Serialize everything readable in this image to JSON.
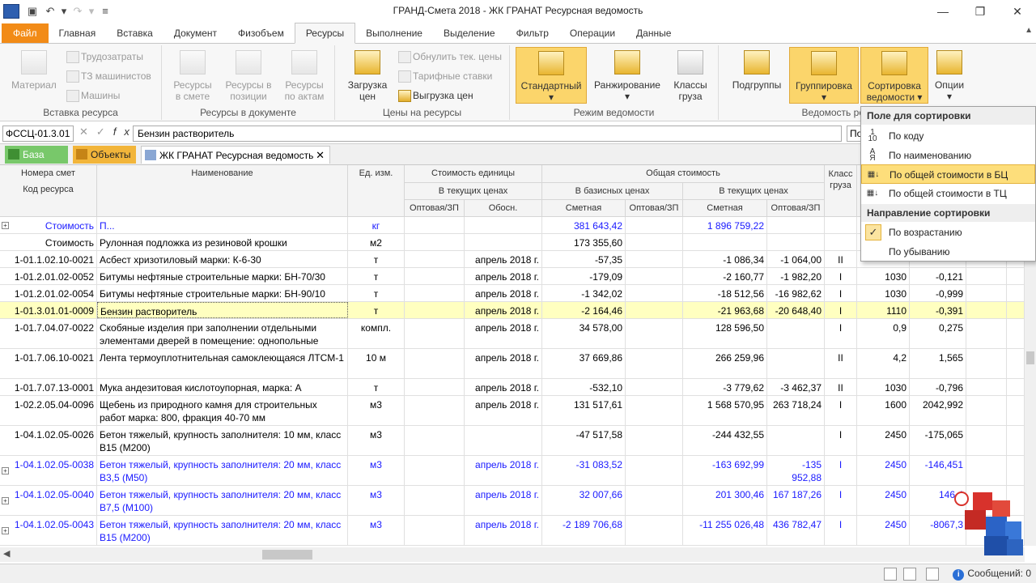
{
  "window": {
    "title": "ГРАНД-Смета 2018 - ЖК ГРАНАТ Ресурсная ведомость"
  },
  "menu_tabs": [
    "Файл",
    "Главная",
    "Вставка",
    "Документ",
    "Физобъем",
    "Ресурсы",
    "Выполнение",
    "Выделение",
    "Фильтр",
    "Операции",
    "Данные"
  ],
  "ribbon": {
    "insert_group": {
      "label": "Вставка ресурса",
      "material": "Материал",
      "labor": "Трудозатраты",
      "machinists": "ТЗ машинистов",
      "machines": "Машины"
    },
    "doc_group": {
      "label": "Ресурсы в документе",
      "in_estimate_1": "Ресурсы",
      "in_estimate_2": "в смете",
      "in_position_1": "Ресурсы в",
      "in_position_2": "позиции",
      "by_acts_1": "Ресурсы",
      "by_acts_2": "по актам"
    },
    "prices_group": {
      "label": "Цены на ресурсы",
      "load_1": "Загрузка",
      "load_2": "цен",
      "reset": "Обнулить тек. цены",
      "tariff": "Тарифные ставки",
      "unload": "Выгрузка цен"
    },
    "mode_group": {
      "label": "Режим ведомости",
      "standard": "Стандартный",
      "ranking": "Ранжирование",
      "classes_1": "Классы",
      "classes_2": "груза"
    },
    "ved_group": {
      "label": "Ведомость ре",
      "subgroups": "Подгруппы",
      "grouping": "Группировка",
      "sort_1": "Сортировка",
      "sort_2": "ведомости",
      "options": "Опции"
    }
  },
  "formula": {
    "cell_ref": "ФССЦ-01.3.01",
    "value": "Бензин растворитель",
    "right_value": "По"
  },
  "doc_tabs": {
    "base": "База",
    "objects": "Объекты",
    "document": "ЖК ГРАНАТ Ресурсная ведомость"
  },
  "table": {
    "headers": {
      "num": "Номера смет",
      "code": "Код ресурса",
      "name": "Наименование",
      "unit": "Ед. изм.",
      "unit_cost": "Стоимость единицы",
      "current_prices": "В текущих ценах",
      "wholesale": "Оптовая/ЗП",
      "basis": "Обосн.",
      "total_cost": "Общая стоимость",
      "base_prices": "В базисных ценах",
      "current_prices2": "В текущих ценах",
      "estimate": "Сметная",
      "wholesale2": "Оптовая/ЗП",
      "estimate2": "Сметная",
      "wholesale3": "Оптовая/ЗП",
      "class_1": "Класс",
      "class_2": "груза"
    },
    "rows": [
      {
        "code": "Стоимость",
        "name": "П...",
        "unit": "кг",
        "wholesale": "",
        "basis": "",
        "base_est": "381 643,42",
        "base_wh": "",
        "cur_est": "1 896 759,22",
        "cur_wh": "",
        "cls": "",
        "mass": "",
        "diff": "",
        "style": "blue",
        "expander": "+"
      },
      {
        "code": "Стоимость",
        "name": "Рулонная подложка из резиновой крошки",
        "unit": "м2",
        "wholesale": "",
        "basis": "",
        "base_est": "173 355,60",
        "base_wh": "",
        "cur_est": "",
        "cur_wh": "",
        "cls": "",
        "mass": "",
        "diff": "",
        "style": "",
        "expander": ""
      },
      {
        "code": "1-01.1.02.10-0021",
        "name": "Асбест хризотиловый марки: К-6-30",
        "unit": "т",
        "wholesale": "",
        "basis": "апрель 2018 г.",
        "base_est": "-57,35",
        "base_wh": "",
        "cur_est": "-1 086,34",
        "cur_wh": "-1 064,00",
        "cls": "II",
        "mass": "",
        "diff": "",
        "style": "",
        "expander": ""
      },
      {
        "code": "1-01.2.01.02-0052",
        "name": "Битумы нефтяные строительные марки: БН-70/30",
        "unit": "т",
        "wholesale": "",
        "basis": "апрель 2018 г.",
        "base_est": "-179,09",
        "base_wh": "",
        "cur_est": "-2 160,77",
        "cur_wh": "-1 982,20",
        "cls": "I",
        "mass": "1030",
        "diff": "-0,121",
        "style": "",
        "expander": ""
      },
      {
        "code": "1-01.2.01.02-0054",
        "name": "Битумы нефтяные строительные марки: БН-90/10",
        "unit": "т",
        "wholesale": "",
        "basis": "апрель 2018 г.",
        "base_est": "-1 342,02",
        "base_wh": "",
        "cur_est": "-18 512,56",
        "cur_wh": "-16 982,62",
        "cls": "I",
        "mass": "1030",
        "diff": "-0,999",
        "style": "",
        "expander": ""
      },
      {
        "code": "1-01.3.01.01-0009",
        "name": "Бензин растворитель",
        "unit": "т",
        "wholesale": "",
        "basis": "апрель 2018 г.",
        "base_est": "-2 164,46",
        "base_wh": "",
        "cur_est": "-21 963,68",
        "cur_wh": "-20 648,40",
        "cls": "I",
        "mass": "1110",
        "diff": "-0,391",
        "style": "hl",
        "expander": ""
      },
      {
        "code": "1-01.7.04.07-0022",
        "name": "Скобяные изделия при заполнении отдельными элементами дверей в помещение: однопольные",
        "unit": "компл.",
        "wholesale": "",
        "basis": "апрель 2018 г.",
        "base_est": "34 578,00",
        "base_wh": "",
        "cur_est": "128 596,50",
        "cur_wh": "",
        "cls": "I",
        "mass": "0,9",
        "diff": "0,275",
        "style": "",
        "expander": ""
      },
      {
        "code": "1-01.7.06.10-0021",
        "name": "Лента термоуплотнительная самоклеющаяся ЛТСМ-1",
        "unit": "10 м",
        "wholesale": "",
        "basis": "апрель 2018 г.",
        "base_est": "37 669,86",
        "base_wh": "",
        "cur_est": "266 259,96",
        "cur_wh": "",
        "cls": "II",
        "mass": "4,2",
        "diff": "1,565",
        "style": "",
        "expander": ""
      },
      {
        "code": "1-01.7.07.13-0001",
        "name": "Мука андезитовая кислотоупорная, марка: А",
        "unit": "т",
        "wholesale": "",
        "basis": "апрель 2018 г.",
        "base_est": "-532,10",
        "base_wh": "",
        "cur_est": "-3 779,62",
        "cur_wh": "-3 462,37",
        "cls": "II",
        "mass": "1030",
        "diff": "-0,796",
        "style": "",
        "expander": ""
      },
      {
        "code": "1-02.2.05.04-0096",
        "name": "Щебень из природного камня для строительных работ марка: 800, фракция 40-70 мм",
        "unit": "м3",
        "wholesale": "",
        "basis": "апрель 2018 г.",
        "base_est": "131 517,61",
        "base_wh": "",
        "cur_est": "1 568 570,95",
        "cur_wh": "263 718,24",
        "cls": "I",
        "mass": "1600",
        "diff": "2042,992",
        "style": "",
        "expander": ""
      },
      {
        "code": "1-04.1.02.05-0026",
        "name": "Бетон тяжелый, крупность заполнителя: 10 мм, класс В15 (М200)",
        "unit": "м3",
        "wholesale": "",
        "basis": "",
        "base_est": "-47 517,58",
        "base_wh": "",
        "cur_est": "-244 432,55",
        "cur_wh": "",
        "cls": "I",
        "mass": "2450",
        "diff": "-175,065",
        "style": "",
        "expander": ""
      },
      {
        "code": "1-04.1.02.05-0038",
        "name": "Бетон тяжелый, крупность заполнителя: 20 мм, класс В3,5 (М50)",
        "unit": "м3",
        "wholesale": "",
        "basis": "апрель 2018 г.",
        "base_est": "-31 083,52",
        "base_wh": "",
        "cur_est": "-163 692,99",
        "cur_wh": "-135 952,88",
        "cls": "I",
        "mass": "2450",
        "diff": "-146,451",
        "style": "blue",
        "expander": "+"
      },
      {
        "code": "1-04.1.02.05-0040",
        "name": "Бетон тяжелый, крупность заполнителя: 20 мм, класс В7,5 (М100)",
        "unit": "м3",
        "wholesale": "",
        "basis": "апрель 2018 г.",
        "base_est": "32 007,66",
        "base_wh": "",
        "cur_est": "201 300,46",
        "cur_wh": "167 187,26",
        "cls": "I",
        "mass": "2450",
        "diff": "146,4",
        "style": "blue",
        "expander": "+"
      },
      {
        "code": "1-04.1.02.05-0043",
        "name": "Бетон тяжелый, крупность заполнителя: 20 мм, класс В15 (М200)",
        "unit": "м3",
        "wholesale": "",
        "basis": "апрель 2018 г.",
        "base_est": "-2 189 706,68",
        "base_wh": "",
        "cur_est": "-11 255 026,48",
        "cur_wh": "436 782,47",
        "cls": "I",
        "mass": "2450",
        "diff": "-8067,3",
        "style": "blue",
        "expander": "+"
      }
    ]
  },
  "sort_menu": {
    "field_header": "Поле для сортировки",
    "by_code": "По коду",
    "by_name": "По наименованию",
    "by_total_base": "По общей стоимости в БЦ",
    "by_total_current": "По общей стоимости в ТЦ",
    "direction_header": "Направление сортировки",
    "ascending": "По возрастанию",
    "descending": "По убыванию"
  },
  "status": {
    "messages": "Сообщений: 0"
  },
  "colors": {
    "accent": "#f28b17",
    "highlight_row": "#ffffc0",
    "button_highlight": "#fbd56b",
    "link_blue": "#1a1aff"
  }
}
